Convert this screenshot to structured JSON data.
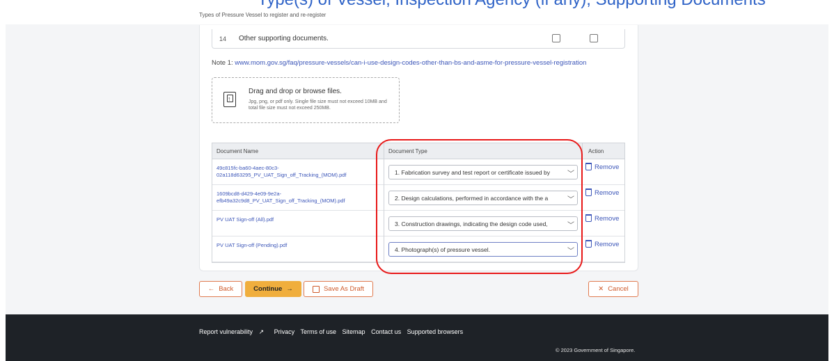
{
  "header": {
    "top_heading": "Type(s) of Vessel, Inspection Agency (if any), Supporting Documents",
    "subnote": "Types of Pressure Vessel to register and re-register"
  },
  "checklist_row": {
    "number": "14",
    "label": "Other supporting documents."
  },
  "note": {
    "prefix": "Note 1: ",
    "link": "www.mom.gov.sg/faq/pressure-vessels/can-i-use-design-codes-other-than-bs-and-asme-for-pressure-vessel-registration"
  },
  "upload": {
    "title": "Drag and drop or browse files.",
    "hint": "Jpg, png, or pdf only. Single file size must not exceed 10MB and total file size must not exceed 250MB."
  },
  "table": {
    "headers": [
      "Document Name",
      "Document Type",
      "Action"
    ],
    "rows": [
      {
        "name": "49c815fc-ba60-4aec-80c3-02a118d63295_PV_UAT_Sign_off_Tracking_(MOM).pdf",
        "type": "1. Fabrication survey and test report or certificate issued by",
        "action": "Remove"
      },
      {
        "name": "1609bcd8-d429-4e09-9e2a-efb49a32c9d8_PV_UAT_Sign_off_Tracking_(MOM).pdf",
        "type": "2. Design calculations, performed in accordance with the a",
        "action": "Remove"
      },
      {
        "name": "PV UAT Sign-off (All).pdf",
        "type": "3. Construction drawings, indicating the design code used,",
        "action": "Remove"
      },
      {
        "name": "PV UAT Sign-off (Pending).pdf",
        "type": "4. Photograph(s) of pressure vessel.",
        "action": "Remove"
      }
    ]
  },
  "buttons": {
    "back": "Back",
    "continue": "Continue",
    "save_draft": "Save As Draft",
    "cancel": "Cancel"
  },
  "footer": {
    "links": [
      "Report vulnerability",
      "Privacy",
      "Terms of use",
      "Sitemap",
      "Contact us",
      "Supported browsers"
    ],
    "copyright": "© 2023 Government of Singapore."
  },
  "colors": {
    "accent_orange": "#f0ae3d",
    "link_blue": "#3b55b8",
    "highlight_red": "#e81818",
    "footer_bg": "#1e2227"
  }
}
